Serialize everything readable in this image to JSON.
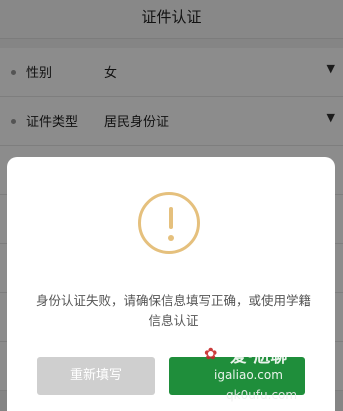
{
  "header": {
    "title": "证件认证"
  },
  "form": {
    "gender": {
      "label": "性别",
      "value": "女"
    },
    "id_type": {
      "label": "证件类型",
      "value": "居民身份证"
    }
  },
  "dialog": {
    "message": "身份认证失败，请确保信息填写正确，或使用学籍信息认证",
    "refill_button": "重新填写",
    "alt_button": ""
  },
  "watermark": {
    "title": "爱·尬聊",
    "url": "igaliao.com",
    "url2": "qk0ufu.com"
  },
  "icons": {
    "row_chevron": "chevron-down-icon",
    "warning": "exclamation-warning-icon"
  },
  "colors": {
    "warning": "#e5c07d",
    "primary_button": "#1f8e3b",
    "secondary_button": "#cfcfcf"
  }
}
